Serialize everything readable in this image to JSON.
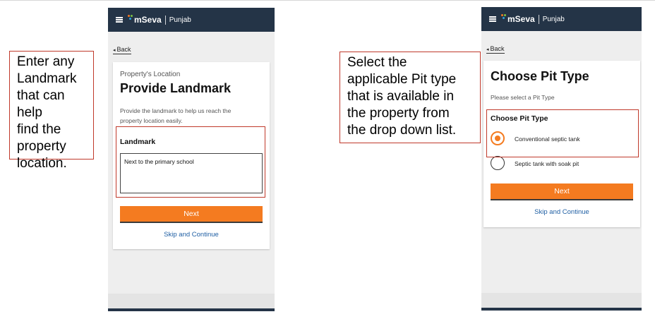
{
  "callouts": {
    "left": [
      "Enter any",
      "Landmark",
      "that can help",
      "find the",
      "property",
      "location."
    ],
    "right": [
      "Select the",
      "applicable Pit type",
      "that is available in",
      "the property from",
      "the drop down list."
    ]
  },
  "app": {
    "brand": "mSeva",
    "city": "Punjab",
    "back_label": "Back",
    "colors": {
      "header": "#243447",
      "accent": "#f47b20",
      "link": "#2160a4",
      "highlight_border": "#c0392b"
    }
  },
  "screen1": {
    "subtitle": "Property's Location",
    "title": "Provide Landmark",
    "description_lines": [
      "Provide the landmark to help us reach the",
      "property location easily."
    ],
    "field_label": "Landmark",
    "field_value": "Next to the primary school",
    "next_label": "Next",
    "skip_label": "Skip and Continue"
  },
  "screen2": {
    "title": "Choose Pit Type",
    "description": "Please select a Pit Type",
    "group_label": "Choose Pit Type",
    "options": [
      {
        "label": "Conventional septic tank",
        "selected": true
      },
      {
        "label": "Septic tank with soak pit",
        "selected": false
      }
    ],
    "next_label": "Next",
    "skip_label": "Skip and Continue"
  }
}
